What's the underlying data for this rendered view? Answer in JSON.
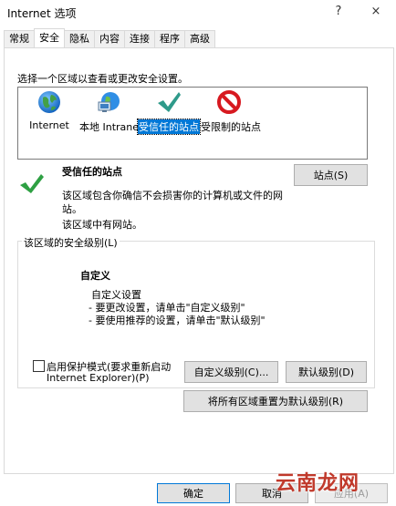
{
  "window": {
    "title": "Internet 选项",
    "help": "?",
    "close": "×"
  },
  "tabs": [
    {
      "label": "常规"
    },
    {
      "label": "安全"
    },
    {
      "label": "隐私"
    },
    {
      "label": "内容"
    },
    {
      "label": "连接"
    },
    {
      "label": "程序"
    },
    {
      "label": "高级"
    }
  ],
  "zones": {
    "prompt": "选择一个区域以查看或更改安全设置。",
    "items": [
      {
        "label": "Internet",
        "icon": "globe-icon"
      },
      {
        "label": "本地 Intranet",
        "icon": "computer-network-icon"
      },
      {
        "label": "受信任的站点",
        "icon": "checkmark-icon",
        "selected": true
      },
      {
        "label": "受限制的站点",
        "icon": "no-entry-icon"
      }
    ]
  },
  "zone_info": {
    "title": "受信任的站点",
    "desc_line1": "该区域包含你确信不会损害你的计算机或文件的网",
    "desc_line2": "站。",
    "note": "该区域中有网站。",
    "sites_button": "站点(S)"
  },
  "security_level": {
    "legend": "该区域的安全级别(L)",
    "title": "自定义",
    "line1": "自定义设置",
    "line2": "- 要更改设置，请单击\"自定义级别\"",
    "line3": "- 要使用推荐的设置，请单击\"默认级别\"",
    "protected_mode_line1": "启用保护模式(要求重新启动",
    "protected_mode_line2": "Internet Explorer)(P)",
    "protected_mode_checked": false,
    "custom_level_button": "自定义级别(C)...",
    "default_level_button": "默认级别(D)",
    "reset_all_button": "将所有区域重置为默认级别(R)"
  },
  "footer": {
    "ok": "确定",
    "cancel": "取消",
    "apply": "应用(A)"
  },
  "watermark": "云南龙网",
  "colors": {
    "selection": "#0078d7",
    "check_green": "#2ea043",
    "no_entry_red": "#d71920"
  }
}
